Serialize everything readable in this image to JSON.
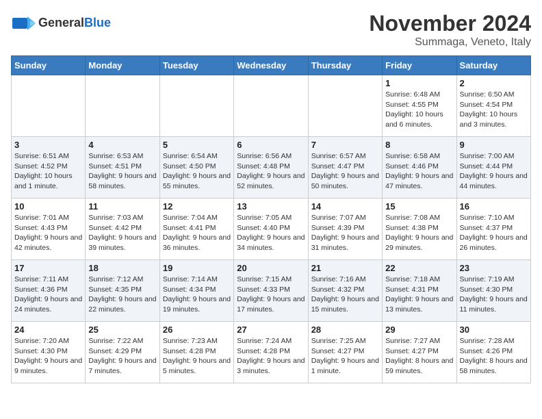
{
  "header": {
    "logo_general": "General",
    "logo_blue": "Blue",
    "month_title": "November 2024",
    "location": "Summaga, Veneto, Italy"
  },
  "calendar": {
    "weekdays": [
      "Sunday",
      "Monday",
      "Tuesday",
      "Wednesday",
      "Thursday",
      "Friday",
      "Saturday"
    ],
    "weeks": [
      [
        {
          "day": "",
          "info": ""
        },
        {
          "day": "",
          "info": ""
        },
        {
          "day": "",
          "info": ""
        },
        {
          "day": "",
          "info": ""
        },
        {
          "day": "",
          "info": ""
        },
        {
          "day": "1",
          "info": "Sunrise: 6:48 AM\nSunset: 4:55 PM\nDaylight: 10 hours and 6 minutes."
        },
        {
          "day": "2",
          "info": "Sunrise: 6:50 AM\nSunset: 4:54 PM\nDaylight: 10 hours and 3 minutes."
        }
      ],
      [
        {
          "day": "3",
          "info": "Sunrise: 6:51 AM\nSunset: 4:52 PM\nDaylight: 10 hours and 1 minute."
        },
        {
          "day": "4",
          "info": "Sunrise: 6:53 AM\nSunset: 4:51 PM\nDaylight: 9 hours and 58 minutes."
        },
        {
          "day": "5",
          "info": "Sunrise: 6:54 AM\nSunset: 4:50 PM\nDaylight: 9 hours and 55 minutes."
        },
        {
          "day": "6",
          "info": "Sunrise: 6:56 AM\nSunset: 4:48 PM\nDaylight: 9 hours and 52 minutes."
        },
        {
          "day": "7",
          "info": "Sunrise: 6:57 AM\nSunset: 4:47 PM\nDaylight: 9 hours and 50 minutes."
        },
        {
          "day": "8",
          "info": "Sunrise: 6:58 AM\nSunset: 4:46 PM\nDaylight: 9 hours and 47 minutes."
        },
        {
          "day": "9",
          "info": "Sunrise: 7:00 AM\nSunset: 4:44 PM\nDaylight: 9 hours and 44 minutes."
        }
      ],
      [
        {
          "day": "10",
          "info": "Sunrise: 7:01 AM\nSunset: 4:43 PM\nDaylight: 9 hours and 42 minutes."
        },
        {
          "day": "11",
          "info": "Sunrise: 7:03 AM\nSunset: 4:42 PM\nDaylight: 9 hours and 39 minutes."
        },
        {
          "day": "12",
          "info": "Sunrise: 7:04 AM\nSunset: 4:41 PM\nDaylight: 9 hours and 36 minutes."
        },
        {
          "day": "13",
          "info": "Sunrise: 7:05 AM\nSunset: 4:40 PM\nDaylight: 9 hours and 34 minutes."
        },
        {
          "day": "14",
          "info": "Sunrise: 7:07 AM\nSunset: 4:39 PM\nDaylight: 9 hours and 31 minutes."
        },
        {
          "day": "15",
          "info": "Sunrise: 7:08 AM\nSunset: 4:38 PM\nDaylight: 9 hours and 29 minutes."
        },
        {
          "day": "16",
          "info": "Sunrise: 7:10 AM\nSunset: 4:37 PM\nDaylight: 9 hours and 26 minutes."
        }
      ],
      [
        {
          "day": "17",
          "info": "Sunrise: 7:11 AM\nSunset: 4:36 PM\nDaylight: 9 hours and 24 minutes."
        },
        {
          "day": "18",
          "info": "Sunrise: 7:12 AM\nSunset: 4:35 PM\nDaylight: 9 hours and 22 minutes."
        },
        {
          "day": "19",
          "info": "Sunrise: 7:14 AM\nSunset: 4:34 PM\nDaylight: 9 hours and 19 minutes."
        },
        {
          "day": "20",
          "info": "Sunrise: 7:15 AM\nSunset: 4:33 PM\nDaylight: 9 hours and 17 minutes."
        },
        {
          "day": "21",
          "info": "Sunrise: 7:16 AM\nSunset: 4:32 PM\nDaylight: 9 hours and 15 minutes."
        },
        {
          "day": "22",
          "info": "Sunrise: 7:18 AM\nSunset: 4:31 PM\nDaylight: 9 hours and 13 minutes."
        },
        {
          "day": "23",
          "info": "Sunrise: 7:19 AM\nSunset: 4:30 PM\nDaylight: 9 hours and 11 minutes."
        }
      ],
      [
        {
          "day": "24",
          "info": "Sunrise: 7:20 AM\nSunset: 4:30 PM\nDaylight: 9 hours and 9 minutes."
        },
        {
          "day": "25",
          "info": "Sunrise: 7:22 AM\nSunset: 4:29 PM\nDaylight: 9 hours and 7 minutes."
        },
        {
          "day": "26",
          "info": "Sunrise: 7:23 AM\nSunset: 4:28 PM\nDaylight: 9 hours and 5 minutes."
        },
        {
          "day": "27",
          "info": "Sunrise: 7:24 AM\nSunset: 4:28 PM\nDaylight: 9 hours and 3 minutes."
        },
        {
          "day": "28",
          "info": "Sunrise: 7:25 AM\nSunset: 4:27 PM\nDaylight: 9 hours and 1 minute."
        },
        {
          "day": "29",
          "info": "Sunrise: 7:27 AM\nSunset: 4:27 PM\nDaylight: 8 hours and 59 minutes."
        },
        {
          "day": "30",
          "info": "Sunrise: 7:28 AM\nSunset: 4:26 PM\nDaylight: 8 hours and 58 minutes."
        }
      ]
    ]
  }
}
